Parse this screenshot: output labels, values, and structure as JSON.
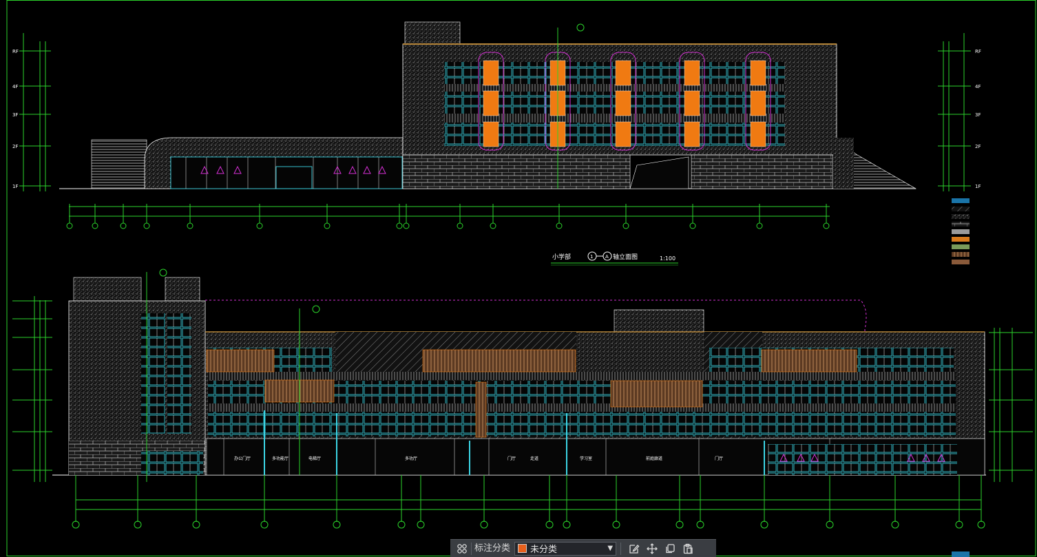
{
  "drawing": {
    "top_title_prefix": "小学部",
    "top_title_suffix": "轴立面图",
    "top_title_axis_a": "1",
    "top_title_axis_b": "A",
    "top_scale": "1:100",
    "floor_labels_left": [
      "RF",
      "4F",
      "3F",
      "2F",
      "1F"
    ],
    "floor_labels_right": [
      "RF",
      "4F",
      "3F",
      "2F",
      "1F"
    ],
    "room_labels_bottom": [
      "办公门厅",
      "多功能厅",
      "电梯厅",
      "多功厅",
      "门厅",
      "走道",
      "学习室",
      "前庭廊道",
      "门厅"
    ],
    "legend_colors": [
      "#1a74a8",
      "#8a8a8a",
      "#b0b0b0",
      "#9a9a9a",
      "#c8c8c8",
      "#d87a1c",
      "#7a9a5a",
      "#c0603c",
      "#b06a38",
      "#8a5a3a"
    ]
  },
  "colors": {
    "line_green": "#2bd42b",
    "line_cyan": "#3cd6e6",
    "line_magenta": "#d52fd5",
    "orange": "#f07a12",
    "white": "#ffffff",
    "sepia": "#b8873a"
  },
  "toolbar": {
    "category_label": "标注分类",
    "selected_category": "未分类",
    "selected_color": "#e8601c",
    "icons": [
      "grid-icon",
      "edit-icon",
      "move-icon",
      "copy-icon",
      "paste-icon"
    ]
  }
}
